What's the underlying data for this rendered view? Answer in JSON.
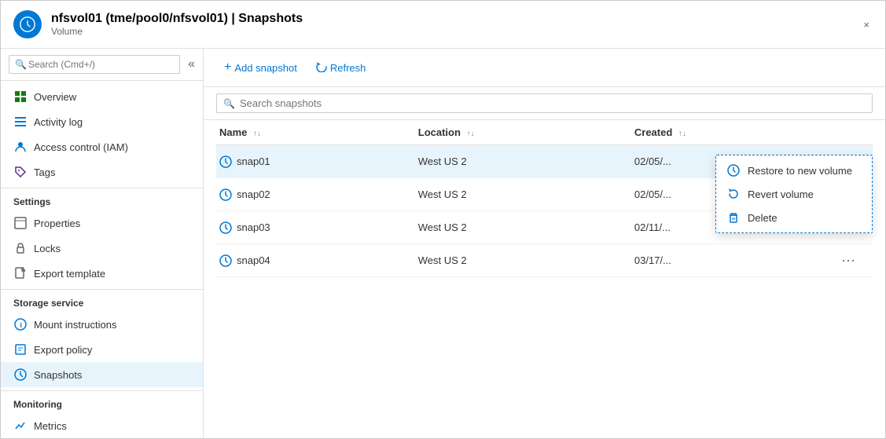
{
  "header": {
    "title": "nfsvol01 (tme/pool0/nfsvol01) | Snapshots",
    "subtitle": "Volume",
    "close_label": "×"
  },
  "sidebar": {
    "search_placeholder": "Search (Cmd+/)",
    "collapse_icon": "«",
    "items": [
      {
        "id": "overview",
        "label": "Overview",
        "icon": "grid-icon"
      },
      {
        "id": "activity-log",
        "label": "Activity log",
        "icon": "list-icon"
      },
      {
        "id": "access-control",
        "label": "Access control (IAM)",
        "icon": "person-icon"
      },
      {
        "id": "tags",
        "label": "Tags",
        "icon": "tag-icon"
      }
    ],
    "sections": [
      {
        "title": "Settings",
        "items": [
          {
            "id": "properties",
            "label": "Properties",
            "icon": "properties-icon"
          },
          {
            "id": "locks",
            "label": "Locks",
            "icon": "lock-icon"
          },
          {
            "id": "export-template",
            "label": "Export template",
            "icon": "export-icon"
          }
        ]
      },
      {
        "title": "Storage service",
        "items": [
          {
            "id": "mount-instructions",
            "label": "Mount instructions",
            "icon": "info-icon"
          },
          {
            "id": "export-policy",
            "label": "Export policy",
            "icon": "policy-icon"
          },
          {
            "id": "snapshots",
            "label": "Snapshots",
            "icon": "snapshot-icon",
            "active": true
          }
        ]
      },
      {
        "title": "Monitoring",
        "items": [
          {
            "id": "metrics",
            "label": "Metrics",
            "icon": "metrics-icon"
          }
        ]
      }
    ]
  },
  "toolbar": {
    "add_snapshot_label": "Add snapshot",
    "refresh_label": "Refresh"
  },
  "search": {
    "placeholder": "Search snapshots"
  },
  "table": {
    "columns": [
      {
        "label": "Name",
        "sortable": true
      },
      {
        "label": "Location",
        "sortable": true
      },
      {
        "label": "Created",
        "sortable": true
      }
    ],
    "rows": [
      {
        "id": "snap01",
        "name": "snap01",
        "location": "West US 2",
        "created": "02/05/...",
        "selected": true
      },
      {
        "id": "snap02",
        "name": "snap02",
        "location": "West US 2",
        "created": "02/05/..."
      },
      {
        "id": "snap03",
        "name": "snap03",
        "location": "West US 2",
        "created": "02/11/..."
      },
      {
        "id": "snap04",
        "name": "snap04",
        "location": "West US 2",
        "created": "03/17/..."
      }
    ]
  },
  "context_menu": {
    "items": [
      {
        "id": "restore",
        "label": "Restore to new volume",
        "icon": "restore-icon"
      },
      {
        "id": "revert",
        "label": "Revert volume",
        "icon": "revert-icon"
      },
      {
        "id": "delete",
        "label": "Delete",
        "icon": "delete-icon"
      }
    ]
  }
}
